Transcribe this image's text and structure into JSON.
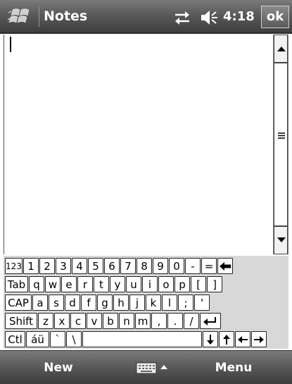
{
  "titlebar": {
    "title": "Notes",
    "time": "4:18",
    "ok_label": "ok",
    "icons": [
      "windows-start-icon",
      "connectivity-icon",
      "volume-icon"
    ]
  },
  "notes": {
    "content": ""
  },
  "keyboard": {
    "rows": [
      [
        "123",
        "1",
        "2",
        "3",
        "4",
        "5",
        "6",
        "7",
        "8",
        "9",
        "0",
        "-",
        "=",
        "backspace-icon"
      ],
      [
        "Tab",
        "q",
        "w",
        "e",
        "r",
        "t",
        "y",
        "u",
        "i",
        "o",
        "p",
        "[",
        "]"
      ],
      [
        "CAP",
        "a",
        "s",
        "d",
        "f",
        "g",
        "h",
        "j",
        "k",
        "l",
        ";",
        "'"
      ],
      [
        "Shift",
        "z",
        "x",
        "c",
        "v",
        "b",
        "n",
        "m",
        ",",
        ".",
        "/",
        "enter-icon"
      ],
      [
        "Ctl",
        "áü",
        "`",
        "\\",
        "space",
        "down-arrow-icon",
        "up-arrow-icon",
        "left-arrow-icon",
        "right-arrow-icon"
      ]
    ]
  },
  "bottombar": {
    "left_softkey": "New",
    "right_softkey": "Menu",
    "sip_icon": "keyboard-icon"
  },
  "colors": {
    "bar_dark": "#3e3e3e",
    "bar_light": "#7a7a7a",
    "keyboard_bg": "#d8d8d8",
    "key_bg": "#ffffff"
  }
}
